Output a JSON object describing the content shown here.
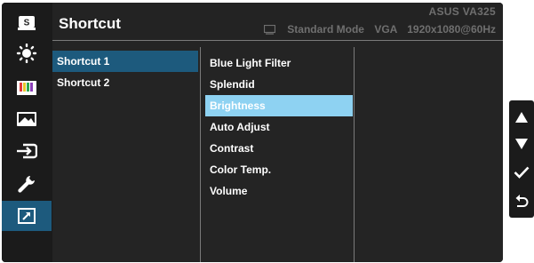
{
  "menu": {
    "title": "Shortcut",
    "model": "ASUS  VA325",
    "status": {
      "mode": "Standard Mode",
      "input": "VGA",
      "resolution": "1920x1080@60Hz"
    }
  },
  "icons": [
    {
      "name": "splendid-icon",
      "glyph": "S"
    },
    {
      "name": "brightness-icon"
    },
    {
      "name": "color-icon"
    },
    {
      "name": "image-icon"
    },
    {
      "name": "input-select-icon"
    },
    {
      "name": "system-setup-icon"
    },
    {
      "name": "shortcut-icon",
      "active": true
    }
  ],
  "shortcut_list": {
    "items": [
      {
        "label": "Shortcut 1",
        "selected": true
      },
      {
        "label": "Shortcut 2",
        "selected": false
      }
    ]
  },
  "option_list": {
    "items": [
      {
        "label": "Blue Light Filter"
      },
      {
        "label": "Splendid"
      },
      {
        "label": "Brightness",
        "highlighted": true
      },
      {
        "label": "Auto Adjust"
      },
      {
        "label": "Contrast"
      },
      {
        "label": "Color Temp."
      },
      {
        "label": "Volume"
      }
    ]
  },
  "colors": {
    "selection": "#1d5a7d",
    "highlight": "#8ed2f2",
    "panel": "#242424"
  },
  "side_buttons": [
    {
      "name": "up-arrow-icon"
    },
    {
      "name": "down-arrow-icon"
    },
    {
      "name": "checkmark-icon"
    },
    {
      "name": "back-icon"
    }
  ]
}
